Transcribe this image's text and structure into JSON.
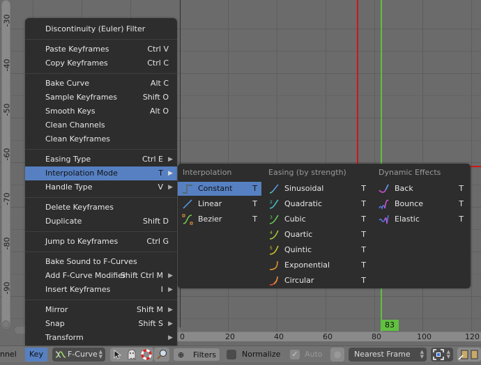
{
  "graph": {
    "y_ticks": [
      "-30",
      "-40",
      "-50",
      "-60",
      "-70",
      "-80",
      "-90"
    ],
    "x_ticks": [
      "0",
      "20",
      "40",
      "60",
      "80",
      "100",
      "120"
    ],
    "current_frame": "83",
    "colors": {
      "playhead": "#60c040",
      "red_marker": "#d01515",
      "accent": "#5680c2"
    }
  },
  "key_menu": {
    "items": [
      {
        "label": "Discontinuity (Euler) Filter",
        "shortcut": ""
      },
      {
        "label": "Paste Keyframes",
        "shortcut": "Ctrl V"
      },
      {
        "label": "Copy Keyframes",
        "shortcut": "Ctrl C"
      },
      {
        "label": "Bake Curve",
        "shortcut": "Alt C"
      },
      {
        "label": "Sample Keyframes",
        "shortcut": "Shift O"
      },
      {
        "label": "Smooth Keys",
        "shortcut": "Alt O"
      },
      {
        "label": "Clean Channels",
        "shortcut": ""
      },
      {
        "label": "Clean Keyframes",
        "shortcut": ""
      },
      {
        "label": "Easing Type",
        "shortcut": "Ctrl E"
      },
      {
        "label": "Interpolation Mode",
        "shortcut": "T"
      },
      {
        "label": "Handle Type",
        "shortcut": "V"
      },
      {
        "label": "Delete Keyframes",
        "shortcut": ""
      },
      {
        "label": "Duplicate",
        "shortcut": "Shift D"
      },
      {
        "label": "Jump to Keyframes",
        "shortcut": "Ctrl G"
      },
      {
        "label": "Bake Sound to F-Curves",
        "shortcut": ""
      },
      {
        "label": "Add F-Curve Modifier",
        "shortcut": "Shift Ctrl M"
      },
      {
        "label": "Insert Keyframes",
        "shortcut": "I"
      },
      {
        "label": "Mirror",
        "shortcut": "Shift M"
      },
      {
        "label": "Snap",
        "shortcut": "Shift S"
      },
      {
        "label": "Transform",
        "shortcut": ""
      }
    ]
  },
  "interpolation_submenu": {
    "columns": [
      {
        "title": "Interpolation",
        "items": [
          {
            "label": "Constant",
            "shortcut": "T",
            "icon": "constant-icon"
          },
          {
            "label": "Linear",
            "shortcut": "T",
            "icon": "linear-icon"
          },
          {
            "label": "Bezier",
            "shortcut": "T",
            "icon": "bezier-icon"
          }
        ]
      },
      {
        "title": "Easing (by strength)",
        "items": [
          {
            "label": "Sinusoidal",
            "shortcut": "T",
            "icon": "sinusoidal-icon"
          },
          {
            "label": "Quadratic",
            "shortcut": "T",
            "icon": "quadratic-icon"
          },
          {
            "label": "Cubic",
            "shortcut": "T",
            "icon": "cubic-icon"
          },
          {
            "label": "Quartic",
            "shortcut": "T",
            "icon": "quartic-icon"
          },
          {
            "label": "Quintic",
            "shortcut": "T",
            "icon": "quintic-icon"
          },
          {
            "label": "Exponential",
            "shortcut": "T",
            "icon": "exponential-icon"
          },
          {
            "label": "Circular",
            "shortcut": "T",
            "icon": "circular-icon"
          }
        ]
      },
      {
        "title": "Dynamic Effects",
        "items": [
          {
            "label": "Back",
            "shortcut": "T",
            "icon": "back-icon"
          },
          {
            "label": "Bounce",
            "shortcut": "T",
            "icon": "bounce-icon"
          },
          {
            "label": "Elastic",
            "shortcut": "T",
            "icon": "elastic-icon"
          }
        ]
      }
    ]
  },
  "header": {
    "channel_menu": "nnel",
    "key_menu": "Key",
    "mode": "F-Curve",
    "filters": "Filters",
    "normalize": "Normalize",
    "auto": "Auto",
    "auto_checked": true,
    "normalize_checked": false,
    "snap_mode": "Nearest Frame"
  }
}
